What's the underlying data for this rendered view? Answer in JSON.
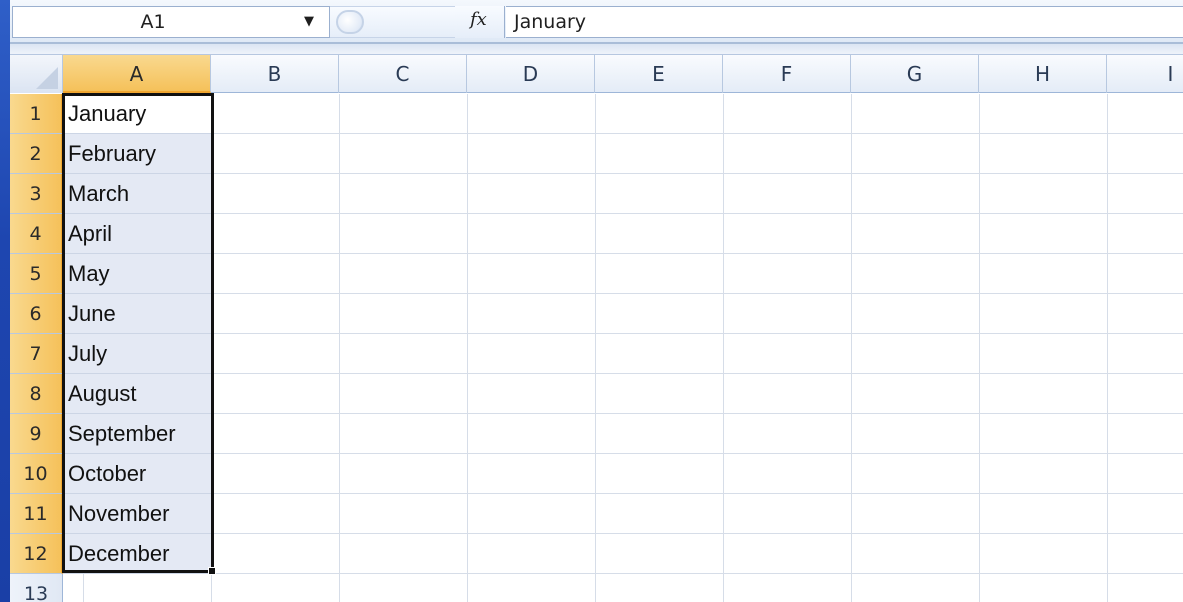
{
  "formula_bar": {
    "name_box": "A1",
    "name_box_arrow": "▼",
    "fx_label": "fx",
    "formula_value": "January"
  },
  "columns": [
    "A",
    "B",
    "C",
    "D",
    "E",
    "F",
    "G",
    "H",
    "I"
  ],
  "rows": [
    "1",
    "2",
    "3",
    "4",
    "5",
    "6",
    "7",
    "8",
    "9",
    "10",
    "11",
    "12",
    "13"
  ],
  "column_a_cells": [
    "January",
    "February",
    "March",
    "April",
    "May",
    "June",
    "July",
    "August",
    "September",
    "October",
    "November",
    "December"
  ],
  "selection": {
    "active_cell": "A1",
    "range": "A1:A12"
  },
  "colors": {
    "selected_header": "#f5c15a",
    "selection_border": "#111111",
    "grid_line": "#d6dde8"
  }
}
